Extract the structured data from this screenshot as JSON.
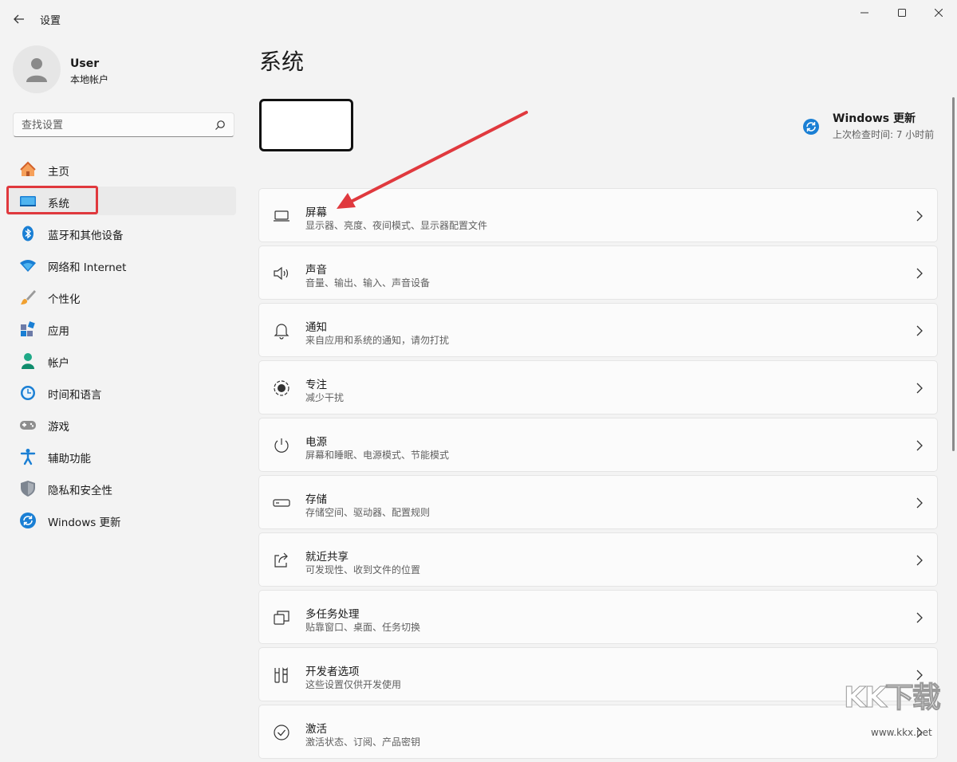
{
  "window": {
    "title": "设置"
  },
  "user": {
    "name": "User",
    "account_type": "本地帐户"
  },
  "search": {
    "placeholder": "查找设置"
  },
  "nav": {
    "items": [
      {
        "label": "主页",
        "icon": "home-icon"
      },
      {
        "label": "系统",
        "icon": "system-icon",
        "active": true
      },
      {
        "label": "蓝牙和其他设备",
        "icon": "bluetooth-icon"
      },
      {
        "label": "网络和 Internet",
        "icon": "wifi-icon"
      },
      {
        "label": "个性化",
        "icon": "brush-icon"
      },
      {
        "label": "应用",
        "icon": "apps-icon"
      },
      {
        "label": "帐户",
        "icon": "account-icon"
      },
      {
        "label": "时间和语言",
        "icon": "time-language-icon"
      },
      {
        "label": "游戏",
        "icon": "gamepad-icon"
      },
      {
        "label": "辅助功能",
        "icon": "accessibility-icon"
      },
      {
        "label": "隐私和安全性",
        "icon": "shield-icon"
      },
      {
        "label": "Windows 更新",
        "icon": "update-icon"
      }
    ]
  },
  "main": {
    "title": "系统",
    "update": {
      "title": "Windows 更新",
      "subtitle": "上次检查时间: 7 小时前"
    },
    "cards": [
      {
        "title": "屏幕",
        "subtitle": "显示器、亮度、夜间模式、显示器配置文件",
        "icon": "display-icon"
      },
      {
        "title": "声音",
        "subtitle": "音量、输出、输入、声音设备",
        "icon": "speaker-icon"
      },
      {
        "title": "通知",
        "subtitle": "来自应用和系统的通知，请勿打扰",
        "icon": "bell-icon"
      },
      {
        "title": "专注",
        "subtitle": "减少干扰",
        "icon": "focus-icon"
      },
      {
        "title": "电源",
        "subtitle": "屏幕和睡眠、电源模式、节能模式",
        "icon": "power-icon"
      },
      {
        "title": "存储",
        "subtitle": "存储空间、驱动器、配置规则",
        "icon": "storage-icon"
      },
      {
        "title": "就近共享",
        "subtitle": "可发现性、收到文件的位置",
        "icon": "share-icon"
      },
      {
        "title": "多任务处理",
        "subtitle": "贴靠窗口、桌面、任务切换",
        "icon": "multitask-icon"
      },
      {
        "title": "开发者选项",
        "subtitle": "这些设置仅供开发使用",
        "icon": "developer-icon"
      },
      {
        "title": "激活",
        "subtitle": "激活状态、订阅、产品密钥",
        "icon": "activation-icon"
      }
    ]
  },
  "watermark": {
    "text": "KK下载",
    "url": "www.kkx.net"
  },
  "colors": {
    "accent": "#005fb8",
    "annotation": "#e0393e",
    "background": "#f3f3f3"
  }
}
